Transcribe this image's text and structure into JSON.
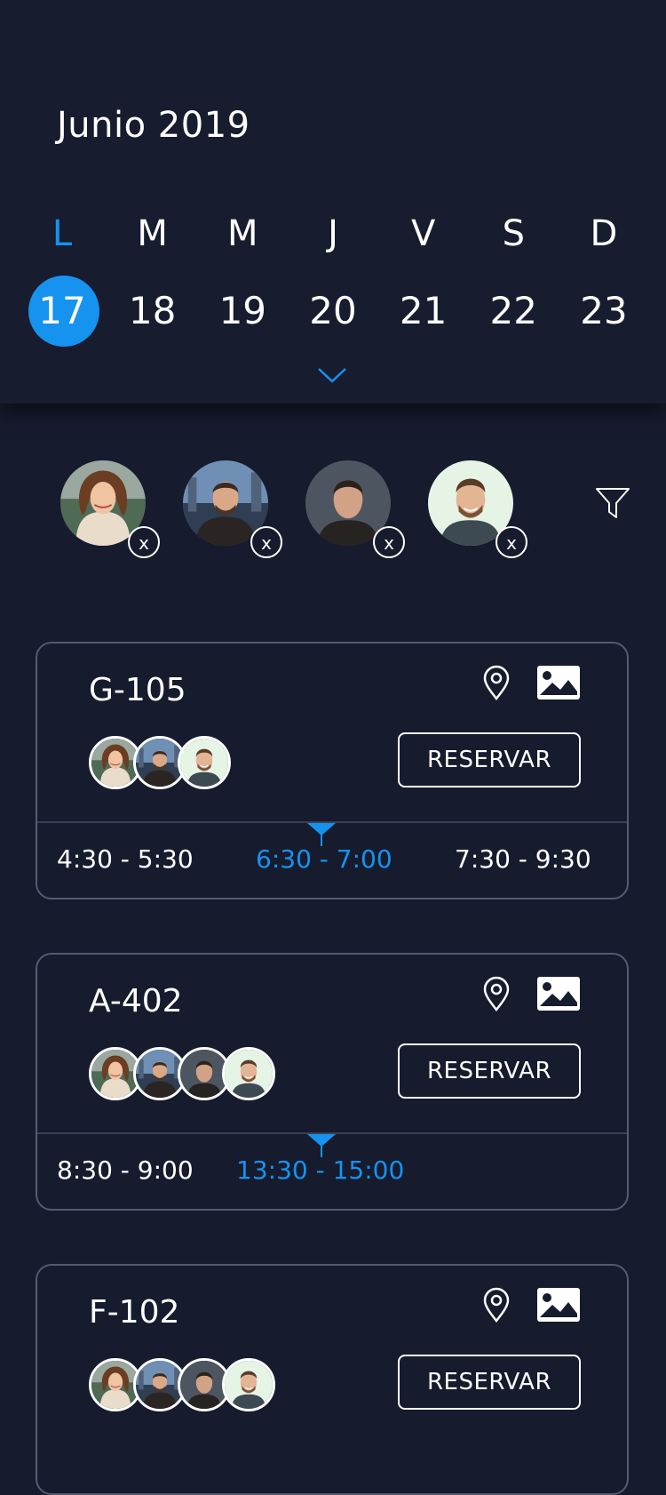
{
  "calendar": {
    "month": "Junio 2019",
    "weekdays": [
      "L",
      "M",
      "M",
      "J",
      "V",
      "S",
      "D"
    ],
    "dates": [
      "17",
      "18",
      "19",
      "20",
      "21",
      "22",
      "23"
    ],
    "selected_index": 0,
    "accent": "#1593ef"
  },
  "filters": {
    "people": [
      {
        "remove": "x",
        "avatar": "woman-long-hair"
      },
      {
        "remove": "x",
        "avatar": "man-beard-city"
      },
      {
        "remove": "x",
        "avatar": "man-short-hair"
      },
      {
        "remove": "x",
        "avatar": "man-smiling-beard"
      }
    ],
    "filter_icon": "funnel-icon"
  },
  "rooms": [
    {
      "code": "G-105",
      "reserve_label": "RESERVAR",
      "slots": [
        "4:30 - 5:30",
        "6:30 - 7:00",
        "7:30 - 9:30"
      ],
      "active_slot": 1,
      "attendees": 3
    },
    {
      "code": "A-402",
      "reserve_label": "RESERVAR",
      "slots": [
        "8:30 - 9:00",
        "13:30 - 15:00"
      ],
      "active_slot": 1,
      "attendees": 4
    },
    {
      "code": "F-102",
      "reserve_label": "RESERVAR",
      "slots": [],
      "attendees": 4
    }
  ]
}
